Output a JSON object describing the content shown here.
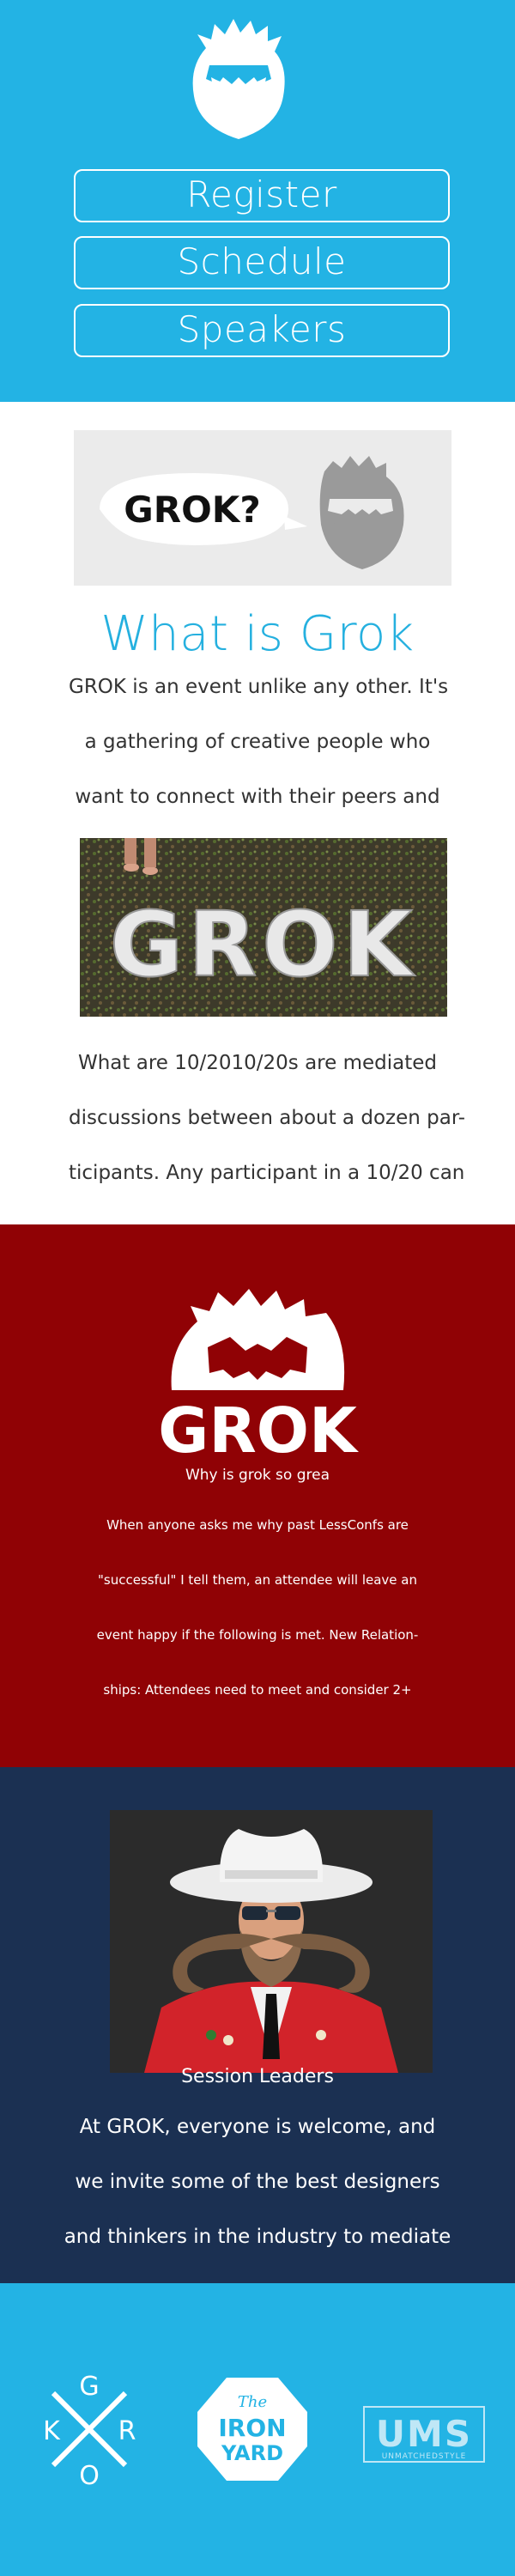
{
  "colors": {
    "sky_blue": "#23b3e4",
    "title_blue": "#25b0df",
    "crimson": "#900205",
    "navy": "#1b3052",
    "white": "#ffffff",
    "text_gray": "#333333"
  },
  "header": {
    "logo_icon": "grok-yeti-head-icon",
    "nav": {
      "register_label": "Register",
      "schedule_label": "Schedule",
      "speakers_label": "Speakers"
    }
  },
  "what_is_grok": {
    "banner_text": "GROK?",
    "title": "What is Grok",
    "intro_lines": [
      "GROK is an event unlike any other. It's",
      "a gathering of creative people who",
      "want to connect with their peers and"
    ],
    "photo_text": "GROK",
    "detail_lines": [
      "What are 10/2010/20s are mediated",
      "discussions between about a dozen par-",
      "ticipants. Any participant in a 10/20 can"
    ]
  },
  "why": {
    "logo_text": "GROK",
    "heading": "Why is grok so grea",
    "lines": [
      "When anyone asks me why past LessConfs are",
      "\"successful\" I tell them, an attendee will leave an",
      "event happy if the following is met. New Relation-",
      "ships: Attendees need to meet and consider 2+"
    ]
  },
  "session_leaders": {
    "photo_icon": "cowboy-mustache-portrait",
    "heading": "Session Leaders",
    "lines": [
      "At GROK, everyone is welcome, and",
      "we invite some of the best designers",
      "and thinkers in the industry to mediate"
    ]
  },
  "sponsors": {
    "grok": {
      "letters": [
        "G",
        "K",
        "R",
        "O"
      ]
    },
    "iron_yard": {
      "the": "The",
      "iron": "IRON",
      "yard": "YARD"
    },
    "ums": {
      "name": "UMS",
      "tagline": "UNMATCHEDSTYLE"
    }
  }
}
